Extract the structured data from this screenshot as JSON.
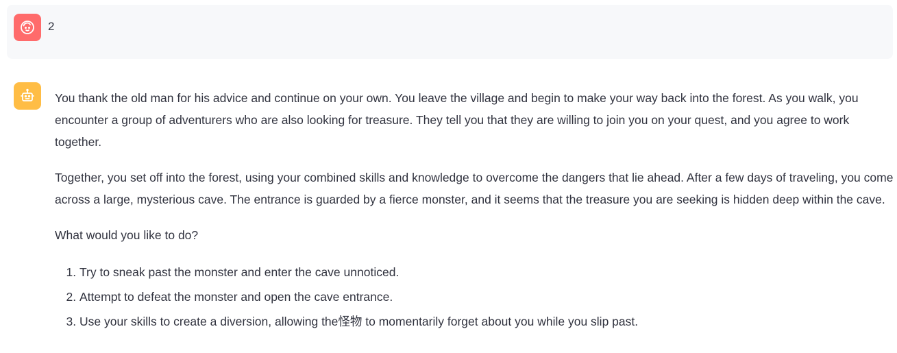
{
  "colors": {
    "user_avatar_bg": "#ff6b6b",
    "bot_avatar_bg": "#ffbd45",
    "user_msg_bg": "#f7f8fa",
    "text": "#31333f"
  },
  "messages": {
    "user": {
      "avatar_icon": "user-face-icon",
      "text": "2"
    },
    "assistant": {
      "avatar_icon": "robot-icon",
      "paragraphs": [
        "You thank the old man for his advice and continue on your own. You leave the village and begin to make your way back into the forest. As you walk, you encounter a group of adventurers who are also looking for treasure. They tell you that they are willing to join you on your quest, and you agree to work together.",
        "Together, you set off into the forest, using your combined skills and knowledge to overcome the dangers that lie ahead. After a few days of traveling, you come across a large, mysterious cave. The entrance is guarded by a fierce monster, and it seems that the treasure you are seeking is hidden deep within the cave.",
        "What would you like to do?"
      ],
      "options": [
        "Try to sneak past the monster and enter the cave unnoticed.",
        "Attempt to defeat the monster and open the cave entrance.",
        "Use your skills to create a diversion, allowing the怪物 to momentarily forget about you while you slip past."
      ]
    }
  }
}
